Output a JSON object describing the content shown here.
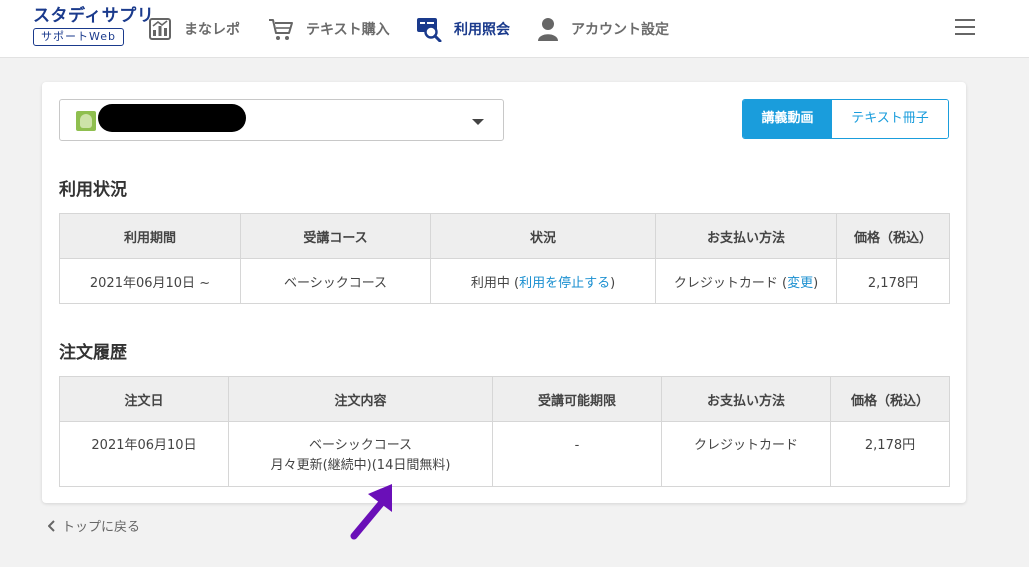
{
  "header": {
    "logo_main": "スタディサプリ",
    "logo_sub": "サポートWeb",
    "nav": [
      {
        "label": "まなレポ",
        "icon": "report-icon"
      },
      {
        "label": "テキスト購入",
        "icon": "cart-icon"
      },
      {
        "label": "利用照会",
        "icon": "card-search-icon"
      },
      {
        "label": "アカウント設定",
        "icon": "user-icon"
      }
    ],
    "active_nav": "利用照会"
  },
  "account_select": {
    "selected_value": ""
  },
  "tabs": {
    "video": "講義動画",
    "text": "テキスト冊子",
    "active": "講義動画"
  },
  "usage": {
    "title": "利用状況",
    "headers": [
      "利用期間",
      "受講コース",
      "状況",
      "お支払い方法",
      "価格（税込）"
    ],
    "row": {
      "period": "2021年06月10日 ~",
      "course": "ベーシックコース",
      "status": "利用中",
      "status_link": "利用を停止する",
      "payment": "クレジットカード",
      "payment_link": "変更",
      "price": "2,178円"
    }
  },
  "orders": {
    "title": "注文履歴",
    "headers": [
      "注文日",
      "注文内容",
      "受講可能期限",
      "お支払い方法",
      "価格（税込）"
    ],
    "row": {
      "date": "2021年06月10日",
      "content_line1": "ベーシックコース",
      "content_line2": "月々更新(継続中)(14日間無料)",
      "deadline": "-",
      "payment": "クレジットカード",
      "price": "2,178円"
    }
  },
  "back_link": "トップに戻る",
  "colors": {
    "brand": "#1a3a8c",
    "accent": "#1a9ddc",
    "annotation_arrow": "#6a0fb8"
  }
}
